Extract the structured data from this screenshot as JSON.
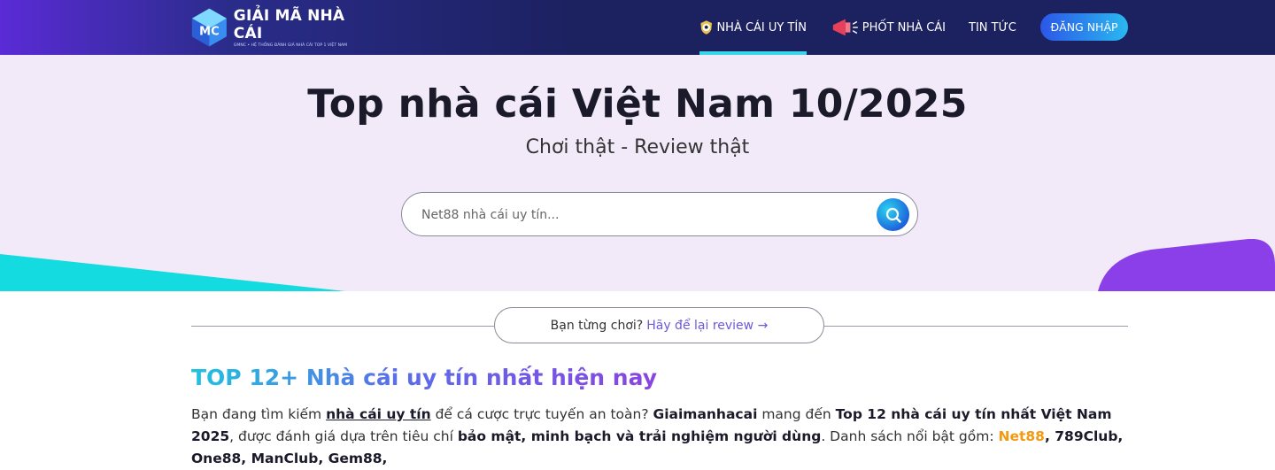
{
  "header": {
    "logo_title": "GIẢI MÃ NHÀ CÁI",
    "logo_subtitle": "GMNC • HỆ THỐNG ĐÁNH GIÁ NHÀ CÁI TOP 1 VIỆT NAM",
    "nav": [
      {
        "label": "NHÀ CÁI UY TÍN",
        "icon": "soccer-shield-icon",
        "active": true
      },
      {
        "label": "PHỐT NHÀ CÁI",
        "icon": "megaphone-icon",
        "active": false
      },
      {
        "label": "TIN TỨC",
        "icon": "",
        "active": false
      }
    ],
    "login_label": "ĐĂNG NHẬP"
  },
  "hero": {
    "title": "Top nhà cái Việt Nam 10/2025",
    "subtitle": "Chơi thật - Review thật",
    "search_placeholder": "Net88 nhà cái uy tín...",
    "search_value": ""
  },
  "review": {
    "prompt": "Bạn từng chơi?",
    "link": "Hãy để lại review →"
  },
  "section": {
    "title": "TOP 12+ Nhà cái uy tín nhất hiện nay",
    "p1_a": "Bạn đang tìm kiếm ",
    "p1_link": "nhà cái uy tín",
    "p1_b": " để cá cược trực tuyến an toàn? ",
    "p1_brand": "Giaimanhacai",
    "p1_c": " mang đến ",
    "p1_bold": "Top 12 nhà cái uy tín nhất Việt Nam 2025",
    "p1_d": ", được đánh giá dựa trên tiêu chí ",
    "p1_criteria": "bảo mật, minh bạch và trải nghiệm người dùng",
    "p1_e": ". Danh sách nổi bật gồm: ",
    "p1_first": "Net88",
    "p1_rest": ", 789Club, One88, ManClub, Gem88,"
  },
  "colors": {
    "header_bg": "#1c2160",
    "accent_cyan": "#38d6e8",
    "hero_bg": "#f3eaf9",
    "link_purple": "#6a5bd6",
    "highlight_orange": "#f39a12"
  }
}
